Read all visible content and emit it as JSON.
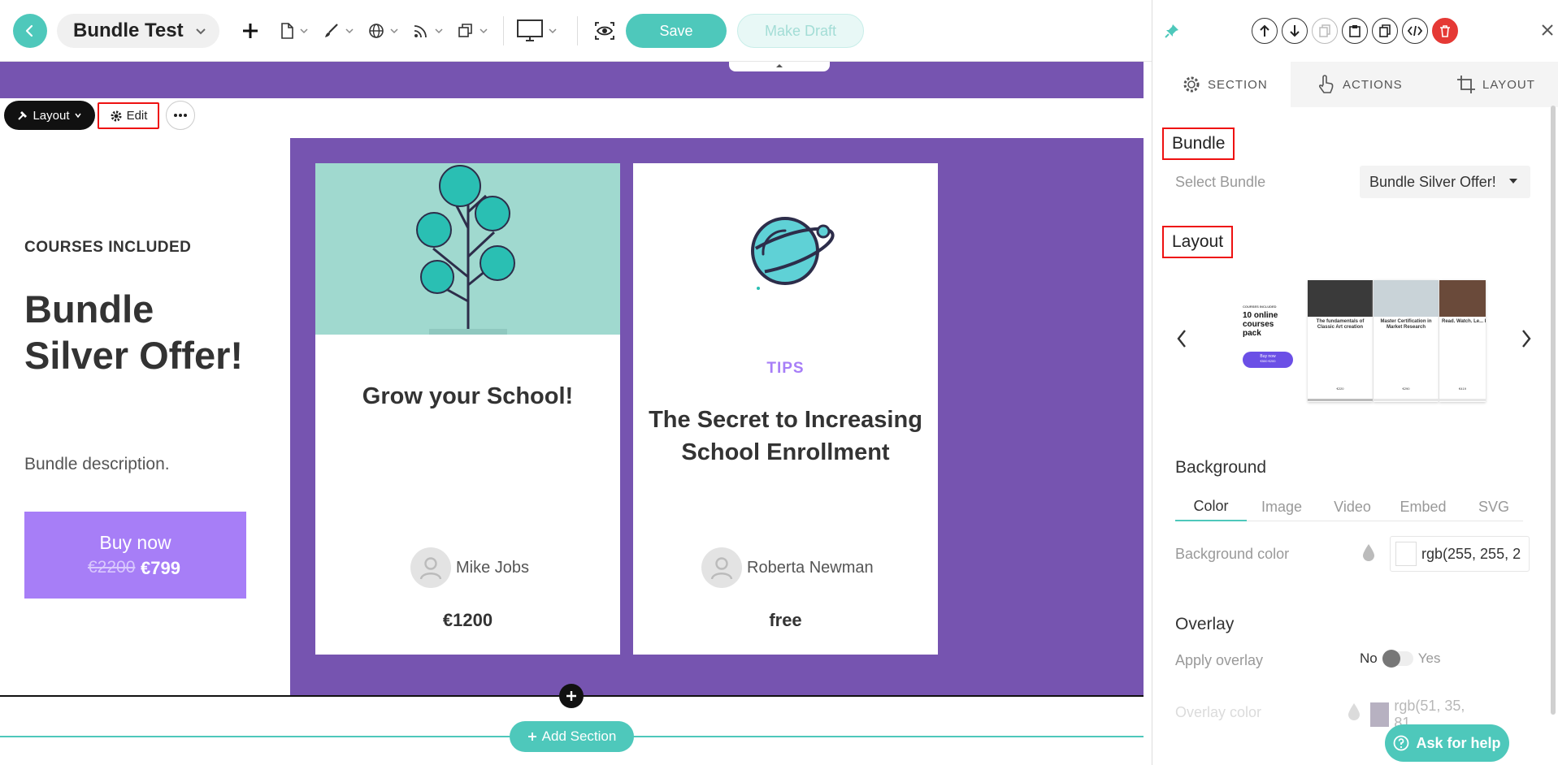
{
  "toolbar": {
    "title": "Bundle Test",
    "save_label": "Save",
    "draft_label": "Make Draft",
    "icons": [
      "back-arrow-icon",
      "plus-icon",
      "page-icon",
      "brush-icon",
      "globe-icon",
      "rss-icon",
      "copy-icon",
      "monitor-icon",
      "preview-eye-icon"
    ]
  },
  "canvas": {
    "layout_chip": "Layout",
    "edit_chip": "Edit",
    "courses_label": "COURSES INCLUDED",
    "bundle_title": "Bundle Silver Offer!",
    "bundle_description": "Bundle description.",
    "buy_now": "Buy now",
    "old_price": "€2200",
    "new_price": "€799",
    "add_section": "Add Section",
    "cards": [
      {
        "title": "Grow your School!",
        "author": "Mike Jobs",
        "price": "€1200"
      },
      {
        "tag": "TIPS",
        "title": "The Secret to Increasing School Enrollment",
        "author": "Roberta Newman",
        "price": "free"
      }
    ]
  },
  "panel": {
    "tabs": [
      {
        "label": "SECTION",
        "icon": "gear-icon"
      },
      {
        "label": "ACTIONS",
        "icon": "hand-pointer-icon"
      },
      {
        "label": "LAYOUT",
        "icon": "crop-icon"
      }
    ],
    "bundle_heading": "Bundle",
    "select_bundle_label": "Select Bundle",
    "select_bundle_value": "Bundle Silver Offer!",
    "layout_heading": "Layout",
    "layout_preview": {
      "courses_label": "COURSES INCLUDED",
      "pack_title": "10 online courses pack",
      "buy_label": "Buy now",
      "price_label": "€500 €200",
      "cards": [
        {
          "title": "The fundamentals of Classic Art creation",
          "price": "€220"
        },
        {
          "title": "Master Certification in Market Research",
          "price": "€290"
        },
        {
          "title": "Read. Watch. Le... Improve.",
          "price": "€419"
        }
      ]
    },
    "background_heading": "Background",
    "background_tabs": [
      "Color",
      "Image",
      "Video",
      "Embed",
      "SVG"
    ],
    "background_color_label": "Background color",
    "background_color_value": "rgb(255, 255, 2",
    "overlay_heading": "Overlay",
    "apply_overlay_label": "Apply overlay",
    "toggle_no": "No",
    "toggle_yes": "Yes",
    "overlay_color_label": "Overlay color",
    "overlay_color_value": "rgb(51, 35, 81",
    "ask_help": "Ask for help"
  },
  "colors": {
    "accent_teal": "#4ec8bb",
    "purple": "#7654b0",
    "buy_purple": "#a77ef7",
    "card_mint": "#a0d9cf",
    "delete_red": "#e53935"
  }
}
